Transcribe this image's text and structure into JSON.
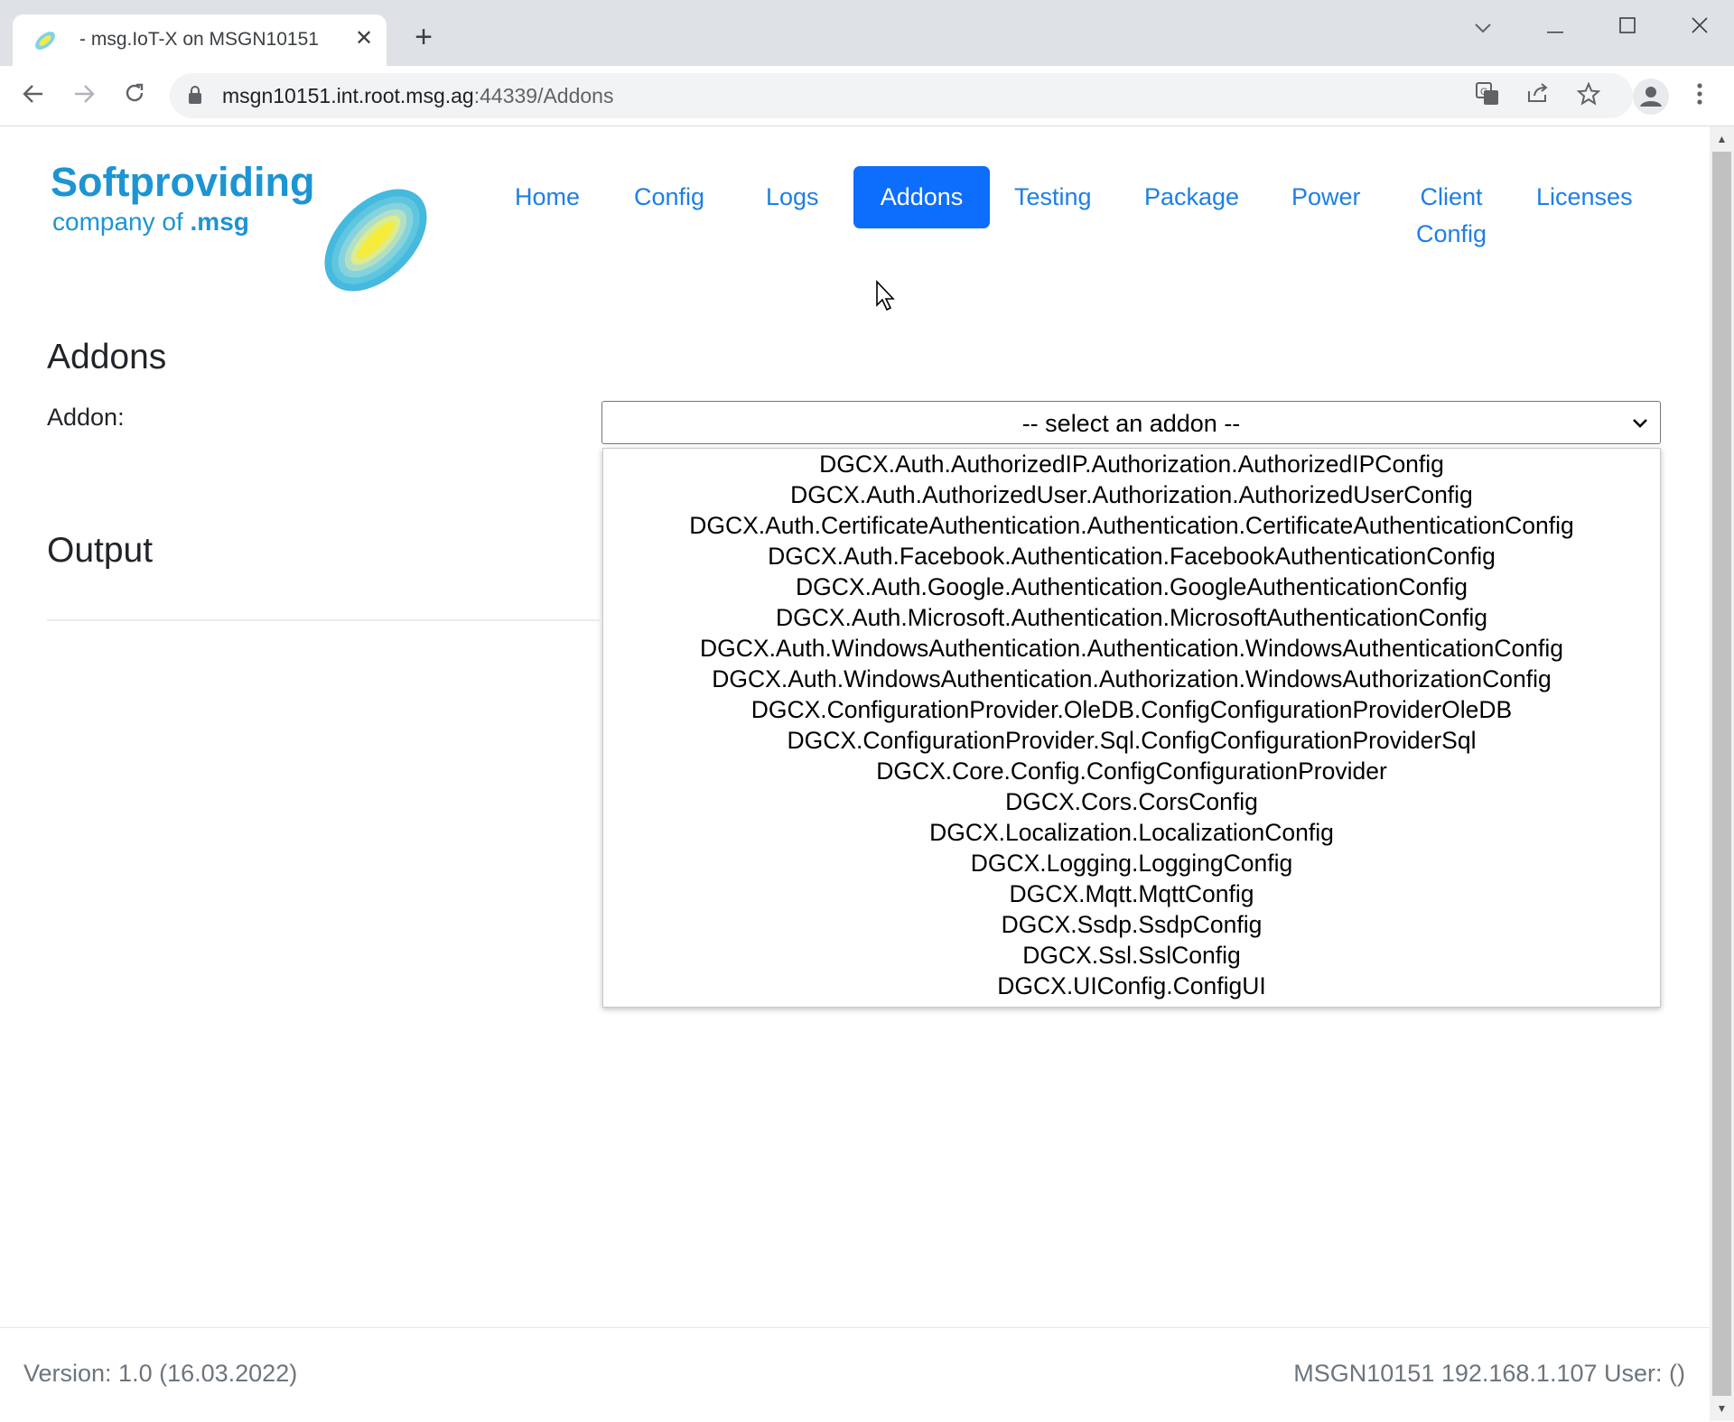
{
  "browser": {
    "tab_title": "- msg.IoT-X on MSGN10151",
    "url_host": "msgn10151.int.root.msg.ag",
    "url_rest": ":44339/Addons",
    "icons": {
      "tab_close": "close-icon",
      "new_tab": "plus-icon",
      "back": "back-arrow-icon",
      "forward": "forward-arrow-icon",
      "reload": "reload-icon",
      "lock": "lock-icon",
      "translate": "translate-icon",
      "share": "share-icon",
      "bookmark": "star-icon",
      "profile": "profile-icon",
      "menu": "kebab-menu-icon",
      "tab_search": "chevron-down-icon",
      "minimize": "minimize-icon",
      "maximize": "maximize-icon",
      "close_window": "close-window-icon"
    }
  },
  "logo": {
    "line1": "Softproviding",
    "line2_prefix": "company of ",
    "line2_brand": ".msg"
  },
  "nav": {
    "home": "Home",
    "config": "Config",
    "logs": "Logs",
    "addons": "Addons",
    "testing": "Testing",
    "package": "Package",
    "power": "Power",
    "client_line1": "Client",
    "client_line2": "Config",
    "licenses": "Licenses",
    "active": "Addons"
  },
  "main": {
    "heading": "Addons",
    "addon_label": "Addon:",
    "select_value": "-- select an addon --",
    "options": [
      "DGCX.Auth.AuthorizedIP.Authorization.AuthorizedIPConfig",
      "DGCX.Auth.AuthorizedUser.Authorization.AuthorizedUserConfig",
      "DGCX.Auth.CertificateAuthentication.Authentication.CertificateAuthenticationConfig",
      "DGCX.Auth.Facebook.Authentication.FacebookAuthenticationConfig",
      "DGCX.Auth.Google.Authentication.GoogleAuthenticationConfig",
      "DGCX.Auth.Microsoft.Authentication.MicrosoftAuthenticationConfig",
      "DGCX.Auth.WindowsAuthentication.Authentication.WindowsAuthenticationConfig",
      "DGCX.Auth.WindowsAuthentication.Authorization.WindowsAuthorizationConfig",
      "DGCX.ConfigurationProvider.OleDB.ConfigConfigurationProviderOleDB",
      "DGCX.ConfigurationProvider.Sql.ConfigConfigurationProviderSql",
      "DGCX.Core.Config.ConfigConfigurationProvider",
      "DGCX.Cors.CorsConfig",
      "DGCX.Localization.LocalizationConfig",
      "DGCX.Logging.LoggingConfig",
      "DGCX.Mqtt.MqttConfig",
      "DGCX.Ssdp.SsdpConfig",
      "DGCX.Ssl.SslConfig",
      "DGCX.UIConfig.ConfigUI"
    ],
    "output_heading": "Output"
  },
  "footer": {
    "version": "Version: 1.0 (16.03.2022)",
    "host_info": "MSGN10151 192.168.1.107 User: ()"
  },
  "colors": {
    "brand": "#1d94d3",
    "link": "#1d7fe6",
    "active_nav": "#0d6efd"
  }
}
